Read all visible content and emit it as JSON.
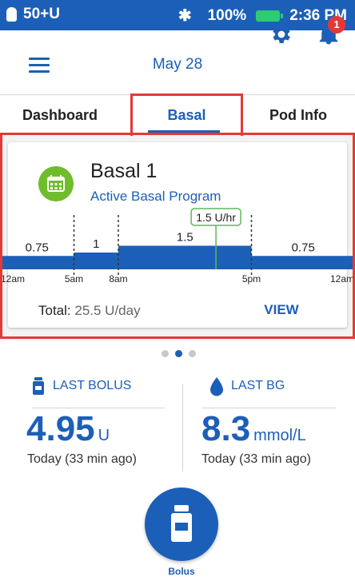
{
  "status_bar": {
    "pod_status": "50+U",
    "battery": "100%",
    "time": "2:36 PM"
  },
  "header": {
    "date": "May 28",
    "notification_count": "1"
  },
  "tabs": [
    {
      "label": "Dashboard"
    },
    {
      "label": "Basal"
    },
    {
      "label": "Pod Info"
    }
  ],
  "basal_card": {
    "program_name": "Basal 1",
    "subtitle": "Active Basal Program",
    "total_label": "Total:",
    "total_value": "25.5 U/day",
    "view_label": "VIEW"
  },
  "chart_data": {
    "type": "area",
    "unit": "U/hr",
    "segments": [
      {
        "start": "12am",
        "end": "5am",
        "rate": 0.75,
        "label": "0.75"
      },
      {
        "start": "5am",
        "end": "8am",
        "rate": 1,
        "label": "1"
      },
      {
        "start": "8am",
        "end": "5pm",
        "rate": 1.5,
        "label": "1.5"
      },
      {
        "start": "5pm",
        "end": "12am",
        "rate": 0.75,
        "label": "0.75"
      }
    ],
    "x_ticks": [
      "12am",
      "5am",
      "8am",
      "5pm",
      "12am"
    ],
    "current_rate_label": "1.5 U/hr",
    "current_time_label": "2:36 PM",
    "color": "#1c5fb8",
    "current_marker_color": "#5cb85c"
  },
  "pager": {
    "pages": 3,
    "active_index": 1
  },
  "last_bolus": {
    "label": "LAST BOLUS",
    "value": "4.95",
    "unit": "U",
    "time": "Today (33 min ago)"
  },
  "last_bg": {
    "label": "LAST BG",
    "value": "8.3",
    "unit": "mmol/L",
    "time": "Today (33 min ago)"
  },
  "bolus_button": {
    "label": "Bolus"
  },
  "colors": {
    "primary": "#1c5fb8",
    "highlight": "#e53935",
    "program_icon": "#6fbd2c",
    "battery": "#2ecc71"
  },
  "icons": [
    "lock-icon",
    "bluetooth-icon",
    "battery-icon",
    "menu-icon",
    "gear-icon",
    "bell-icon",
    "calendar-icon",
    "insulin-vial-icon",
    "blood-drop-icon",
    "bolus-vial-icon"
  ]
}
